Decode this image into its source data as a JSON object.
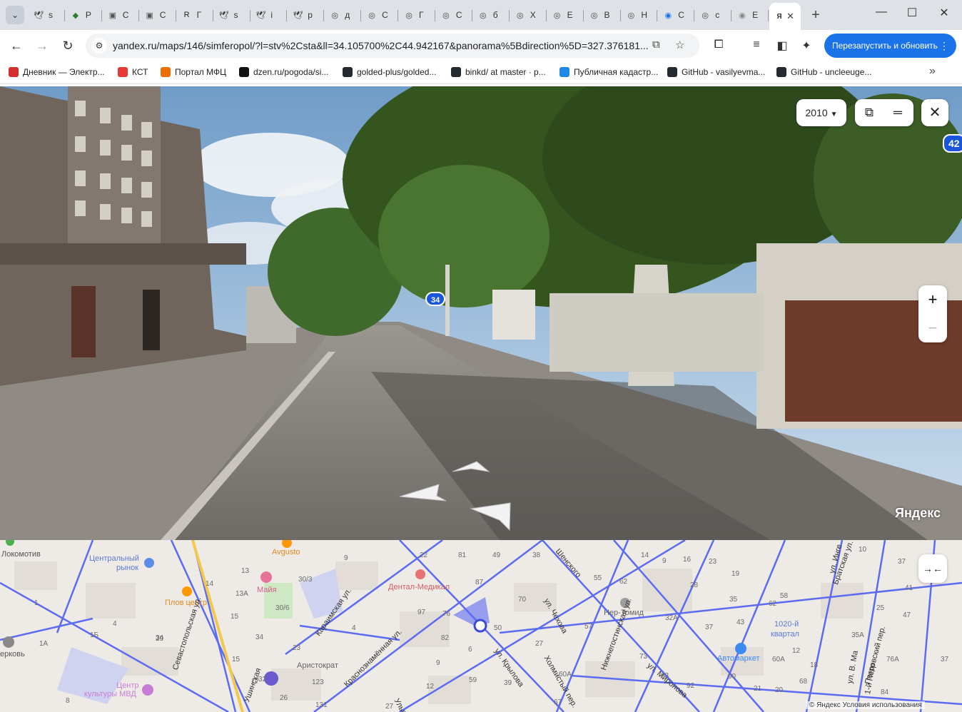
{
  "tabs": [
    {
      "label": "s",
      "icon": "bird-icon",
      "color": "#333333"
    },
    {
      "label": "P",
      "icon": "gem-icon",
      "color": "#2e7d32"
    },
    {
      "label": "C",
      "icon": "picture-icon",
      "color": "#555555"
    },
    {
      "label": "C",
      "icon": "picture-icon",
      "color": "#555555"
    },
    {
      "label": "Г",
      "icon": "r-icon",
      "color": "#222222"
    },
    {
      "label": "s",
      "icon": "bird-icon",
      "color": "#333333"
    },
    {
      "label": "i",
      "icon": "bird-icon",
      "color": "#333333"
    },
    {
      "label": "p",
      "icon": "bird-icon",
      "color": "#333333"
    },
    {
      "label": "д",
      "icon": "target-icon",
      "color": "#444444"
    },
    {
      "label": "С",
      "icon": "target-icon",
      "color": "#444444"
    },
    {
      "label": "Г",
      "icon": "target-icon",
      "color": "#444444"
    },
    {
      "label": "С",
      "icon": "target-icon",
      "color": "#444444"
    },
    {
      "label": "б",
      "icon": "target-icon",
      "color": "#444444"
    },
    {
      "label": "Х",
      "icon": "target-icon",
      "color": "#444444"
    },
    {
      "label": "Е",
      "icon": "target-icon",
      "color": "#444444"
    },
    {
      "label": "В",
      "icon": "target-icon",
      "color": "#444444"
    },
    {
      "label": "Н",
      "icon": "target-icon",
      "color": "#444444"
    },
    {
      "label": "С",
      "icon": "globe-icon",
      "color": "#1a73e8"
    },
    {
      "label": "с",
      "icon": "target-icon",
      "color": "#444444"
    },
    {
      "label": "Е",
      "icon": "globe-icon",
      "color": "#888888"
    }
  ],
  "active_tab": {
    "label": "Я",
    "icon": "yandex-icon"
  },
  "new_tab": "+",
  "window_controls": {
    "minimize": "—",
    "maximize": "☐",
    "close": "✕"
  },
  "url": "yandex.ru/maps/146/simferopol/?l=stv%2Csta&ll=34.105700%2C44.942167&panorama%5Bdirection%5D=327.376181...",
  "relaunch_label": "Перезапустить и обновить",
  "bookmarks": [
    {
      "label": "Дневник — Электр...",
      "color": "#d32f2f"
    },
    {
      "label": "КСТ",
      "color": "#e53935"
    },
    {
      "label": "Портал МФЦ",
      "color": "#ef6c00"
    },
    {
      "label": "dzen.ru/pogoda/si...",
      "color": "#111111"
    },
    {
      "label": "golded-plus/golded...",
      "color": "#24292f"
    },
    {
      "label": "binkd/ at master · p...",
      "color": "#24292f"
    },
    {
      "label": "Публичная кадастр...",
      "color": "#1e88e5"
    },
    {
      "label": "GitHub - vasilyevma...",
      "color": "#24292f"
    },
    {
      "label": "GitHub - uncleeuge...",
      "color": "#24292f"
    }
  ],
  "panorama": {
    "year": "2010",
    "year_caret": "▼",
    "house_numbers": [
      "34",
      "42"
    ],
    "brand": "Яндекс",
    "zoom_in": "+",
    "zoom_out": "−"
  },
  "map": {
    "labels": [
      {
        "text": "Локомотив"
      },
      {
        "text": "Центральный"
      },
      {
        "text": "рынок"
      },
      {
        "text": "Avgusto"
      },
      {
        "text": "Майя"
      },
      {
        "text": "Плов центр"
      },
      {
        "text": "Дентал-Медикал"
      },
      {
        "text": "Нер-Томид"
      },
      {
        "text": "1020-й"
      },
      {
        "text": "квартал"
      },
      {
        "text": "Автомаркет"
      },
      {
        "text": "Аристократ"
      },
      {
        "text": "Центр"
      },
      {
        "text": "культуры МВД"
      },
      {
        "text": "ерковь"
      },
      {
        "text": "Караимская ул."
      },
      {
        "text": "Краснознамённая ул."
      },
      {
        "text": "ул. Чехова"
      },
      {
        "text": "ул. Крылова"
      },
      {
        "text": "Холмистый пер."
      },
      {
        "text": "Нижнегостинская ул."
      },
      {
        "text": "ул. Миронова"
      },
      {
        "text": "Севастопольская ул."
      },
      {
        "text": "Братская ул."
      },
      {
        "text": "Петровский пер."
      },
      {
        "text": "ул. Инге"
      },
      {
        "text": "ул. В. Ма"
      },
      {
        "text": "1-й Петр"
      },
      {
        "text": "Шенского"
      },
      {
        "text": "Ульяновская"
      },
      {
        "text": "Ушинская"
      }
    ],
    "numbers": [
      "22",
      "81",
      "49",
      "38",
      "14",
      "9",
      "16",
      "23",
      "10",
      "37",
      "9",
      "13",
      "30/3",
      "14",
      "13А",
      "30/6",
      "87",
      "70",
      "55",
      "62",
      "19",
      "58",
      "35",
      "41",
      "97",
      "76",
      "28",
      "62",
      "82",
      "50",
      "57",
      "32А",
      "37",
      "43",
      "25",
      "1",
      "4",
      "1Б",
      "15",
      "29",
      "34",
      "15",
      "23",
      "4",
      "6",
      "27",
      "73",
      "12",
      "35А",
      "47",
      "8",
      "32",
      "123",
      "9",
      "59",
      "39",
      "60А",
      "83",
      "90",
      "60А",
      "21",
      "76А",
      "37",
      "26",
      "17",
      "12",
      "131",
      "27",
      "67",
      "92",
      "18",
      "20",
      "68",
      "84",
      "1А",
      "34"
    ],
    "collapse_icon": "→←",
    "attribution": "© Яндекс   Условия использования"
  },
  "colors": {
    "accent": "#1a73e8",
    "road": "#5b6bf2",
    "badge": "#1a56db"
  }
}
